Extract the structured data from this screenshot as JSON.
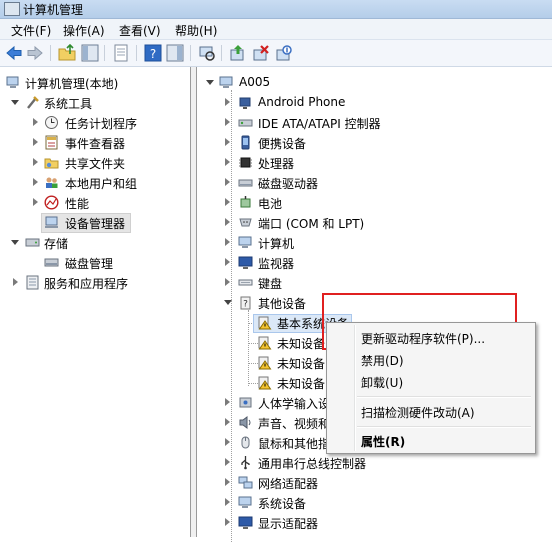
{
  "window": {
    "title": "计算机管理"
  },
  "menu": [
    {
      "label": "文件(F)"
    },
    {
      "label": "操作(A)"
    },
    {
      "label": "查看(V)"
    },
    {
      "label": "帮助(H)"
    }
  ],
  "toolbar": [
    "back-arrow-icon",
    "forward-arrow-icon",
    "up-folder-icon",
    "show-hide-tree-icon",
    "export-list-icon",
    "help-icon",
    "show-hide-action-pane-icon",
    "scan-hardware-icon",
    "update-driver-icon",
    "uninstall-device-icon",
    "disable-device-icon"
  ],
  "left_tree": {
    "root": "计算机管理(本地)",
    "system_tools": "系统工具",
    "task_scheduler": "任务计划程序",
    "event_viewer": "事件查看器",
    "shared_folders": "共享文件夹",
    "local_users": "本地用户和组",
    "performance": "性能",
    "device_manager": "设备管理器",
    "storage": "存储",
    "disk_management": "磁盘管理",
    "services_apps": "服务和应用程序"
  },
  "device_tree": {
    "computer": "A005",
    "categories": [
      "Android Phone",
      "IDE ATA/ATAPI 控制器",
      "便携设备",
      "处理器",
      "磁盘驱动器",
      "电池",
      "端口 (COM 和 LPT)",
      "计算机",
      "监视器",
      "键盘",
      "其他设备"
    ],
    "other_devices": [
      "基本系统设备",
      "未知设备",
      "未知设备",
      "未知设备"
    ],
    "more_categories": [
      "人体学输入设",
      "声音、视频和",
      "鼠标和其他指",
      "通用串行总线控制器",
      "网络适配器",
      "系统设备",
      "显示适配器"
    ]
  },
  "context_menu": {
    "update_driver": "更新驱动程序软件(P)...",
    "disable": "禁用(D)",
    "uninstall": "卸载(U)",
    "scan": "扫描检测硬件改动(A)",
    "properties": "属性(R)"
  }
}
